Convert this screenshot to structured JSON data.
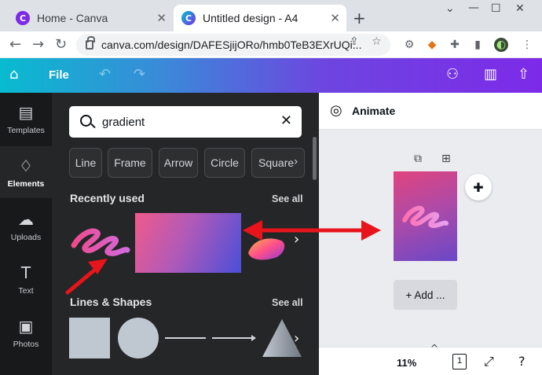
{
  "browser": {
    "tabs": [
      {
        "title": "Home - Canva",
        "favicon": "canva-favicon"
      },
      {
        "title": "Untitled design - A4",
        "favicon": "canva-favicon"
      }
    ],
    "url": "canva.com/design/DAFESjijORo/hmb0TeB3EXrUQi..."
  },
  "header": {
    "file_label": "File"
  },
  "rail": [
    {
      "label": "Templates",
      "icon": "templates-icon"
    },
    {
      "label": "Elements",
      "icon": "elements-icon"
    },
    {
      "label": "Uploads",
      "icon": "upload-cloud-icon"
    },
    {
      "label": "Text",
      "icon": "text-t-icon"
    },
    {
      "label": "Photos",
      "icon": "photo-icon"
    }
  ],
  "panel": {
    "search_value": "gradient",
    "chips": [
      "Line",
      "Frame",
      "Arrow",
      "Circle",
      "Square"
    ],
    "recently_used": {
      "title": "Recently used",
      "see_all": "See all"
    },
    "lines_shapes": {
      "title": "Lines & Shapes",
      "see_all": "See all"
    }
  },
  "canvas": {
    "animate_label": "Animate",
    "add_page_label": "+ Add ...",
    "zoom": "11%",
    "page_count": "1"
  },
  "colors": {
    "annotation_arrow": "#e8141c",
    "header_gradient_start": "#08bbd0",
    "header_gradient_end": "#7d2ae8",
    "panel_bg": "#252627"
  }
}
